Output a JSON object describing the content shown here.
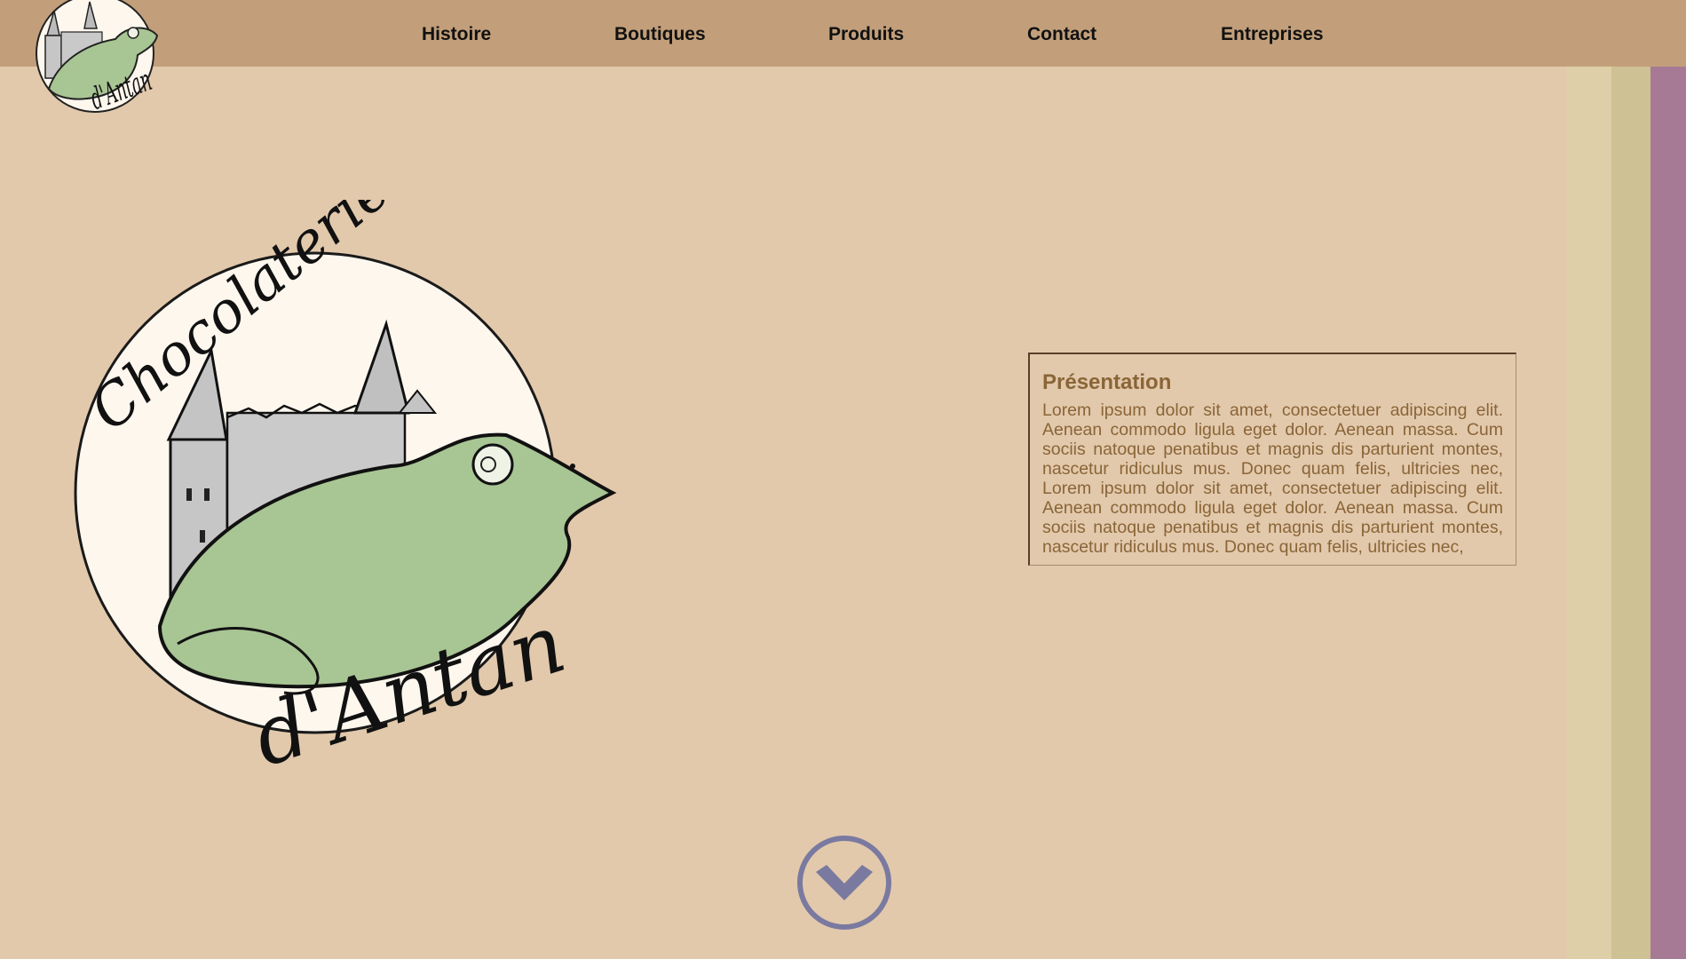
{
  "brand": {
    "name_line1": "Chocolaterie",
    "name_line2": "d'Antan",
    "mini_logo_text": "d'Antan"
  },
  "nav": {
    "items": [
      {
        "label": "Histoire"
      },
      {
        "label": "Boutiques"
      },
      {
        "label": "Produits"
      },
      {
        "label": "Contact"
      },
      {
        "label": "Entreprises"
      }
    ]
  },
  "presentation": {
    "title": "Présentation",
    "body": "Lorem ipsum dolor sit amet, consectetuer adipiscing elit. Aenean commodo ligula eget dolor. Aenean massa. Cum sociis natoque penatibus et magnis dis parturient montes, nascetur ridiculus mus. Donec quam felis, ultricies nec, Lorem ipsum dolor sit amet, consectetuer adipiscing elit. Aenean commodo ligula eget dolor. Aenean massa. Cum sociis natoque penatibus et magnis dis parturient montes, nascetur ridiculus mus. Donec quam felis, ultricies nec,"
  },
  "icons": {
    "scroll": "chevron-down-circle-icon"
  },
  "colors": {
    "background": "#e2c9ac",
    "navbar": "#c29f7a",
    "stripe_light": "#dfcfa8",
    "stripe_mid": "#cec194",
    "stripe_accent": "#a67a95",
    "text_brown": "#8a6537",
    "frog_green": "#a8c594",
    "scroll_button": "#7a7aa0"
  }
}
